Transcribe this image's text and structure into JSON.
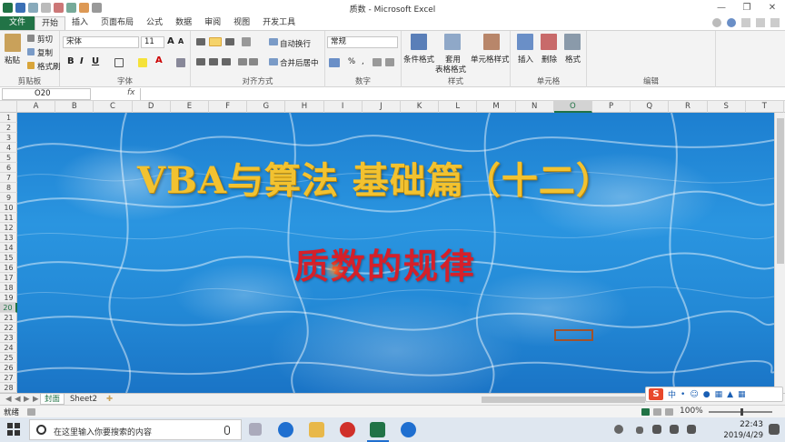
{
  "window": {
    "title": "质数 - Microsoft Excel"
  },
  "tabs": [
    "文件",
    "开始",
    "插入",
    "页面布局",
    "公式",
    "数据",
    "审阅",
    "视图",
    "开发工具"
  ],
  "ribbon": {
    "clipboard": {
      "label": "剪贴板",
      "paste": "粘贴",
      "cut": "剪切",
      "copy": "复制",
      "format_painter": "格式刷"
    },
    "font": {
      "label": "字体",
      "font_name": "宋体",
      "font_size": "11",
      "bold": "B",
      "italic": "I",
      "underline": "U"
    },
    "alignment": {
      "label": "对齐方式",
      "wrap_text": "自动换行",
      "merge_center": "合并后居中"
    },
    "number": {
      "label": "数字",
      "format": "常规",
      "percent": "%",
      "comma": ","
    },
    "styles": {
      "label": "样式",
      "conditional": "条件格式",
      "table_format_1": "套用",
      "table_format_2": "表格格式",
      "cell_styles": "单元格样式"
    },
    "cells": {
      "label": "单元格",
      "insert": "插入",
      "delete": "删除",
      "format": "格式"
    },
    "editing": {
      "label": "编辑"
    }
  },
  "formula_bar": {
    "name_box": "O20",
    "fx": "fx",
    "value": ""
  },
  "columns": [
    "A",
    "B",
    "C",
    "D",
    "E",
    "F",
    "G",
    "H",
    "I",
    "J",
    "K",
    "L",
    "M",
    "N",
    "O",
    "P",
    "Q",
    "R",
    "S",
    "T"
  ],
  "active_column": "O",
  "rows": [
    "1",
    "2",
    "3",
    "4",
    "5",
    "6",
    "7",
    "8",
    "9",
    "10",
    "11",
    "12",
    "13",
    "14",
    "15",
    "16",
    "17",
    "18",
    "19",
    "20",
    "21",
    "22",
    "23",
    "24",
    "25",
    "26",
    "27",
    "28"
  ],
  "active_row": "20",
  "slide": {
    "title": "VBA与算法 基础篇（十二）",
    "subtitle": "质数的规律",
    "title_color": "#f2c230",
    "subtitle_color": "#d5202a"
  },
  "sheets": [
    "封面",
    "Sheet2"
  ],
  "active_sheet": "封面",
  "ime": {
    "lang": "中"
  },
  "status": {
    "mode": "就绪",
    "zoom": "100%"
  },
  "taskbar": {
    "search_placeholder": "在这里输入你要搜索的内容",
    "time": "22:43",
    "date": "2019/4/29"
  },
  "colors": {
    "excel_green": "#217346",
    "water_blue": "#2389d6"
  }
}
